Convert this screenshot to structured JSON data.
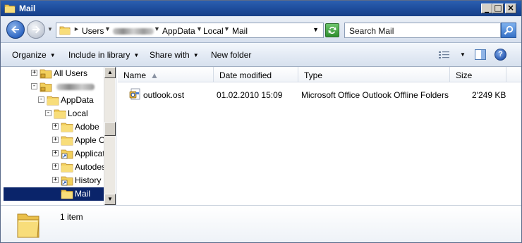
{
  "window": {
    "title": "Mail",
    "caption_buttons": {
      "minimize": "_",
      "maximize": "□",
      "close": "×"
    }
  },
  "address_bar": {
    "breadcrumbs": [
      "Users",
      "AppData",
      "Local",
      "Mail"
    ],
    "redacted_segment": "username (blurred)"
  },
  "search": {
    "placeholder": "Search Mail"
  },
  "toolbar": {
    "organize": "Organize",
    "include_in_library": "Include in library",
    "share_with": "Share with",
    "new_folder": "New folder"
  },
  "nav_tree": {
    "items": [
      {
        "label": "All Users",
        "expander": "+",
        "icon": "locked-folder-icon"
      },
      {
        "label": "",
        "expander": "-",
        "icon": "locked-folder-icon"
      },
      {
        "label": "AppData",
        "expander": "-",
        "icon": "folder-icon"
      },
      {
        "label": "Local",
        "expander": "-",
        "icon": "folder-icon"
      },
      {
        "label": "Adobe",
        "expander": "+",
        "icon": "folder-icon"
      },
      {
        "label": "Apple Co",
        "expander": "+",
        "icon": "folder-icon"
      },
      {
        "label": "Applicati",
        "expander": "+",
        "icon": "shortcut-folder-icon"
      },
      {
        "label": "Autodes",
        "expander": "+",
        "icon": "folder-icon"
      },
      {
        "label": "History",
        "expander": "+",
        "icon": "shortcut-folder-icon"
      },
      {
        "label": "Mail",
        "expander": "",
        "icon": "folder-icon",
        "selected": true
      }
    ]
  },
  "file_list": {
    "columns": [
      "Name",
      "Date modified",
      "Type",
      "Size"
    ],
    "rows": [
      {
        "name": "outlook.ost",
        "date_modified": "01.02.2010 15:09",
        "type": "Microsoft Office Outlook Offline Folders",
        "size": "2'249 KB"
      }
    ]
  },
  "details_pane": {
    "status": "1 item"
  },
  "colors": {
    "title_bar": "#1c4a99",
    "selection": "#0a246a",
    "folder_yellow": "#f2cf5b"
  }
}
